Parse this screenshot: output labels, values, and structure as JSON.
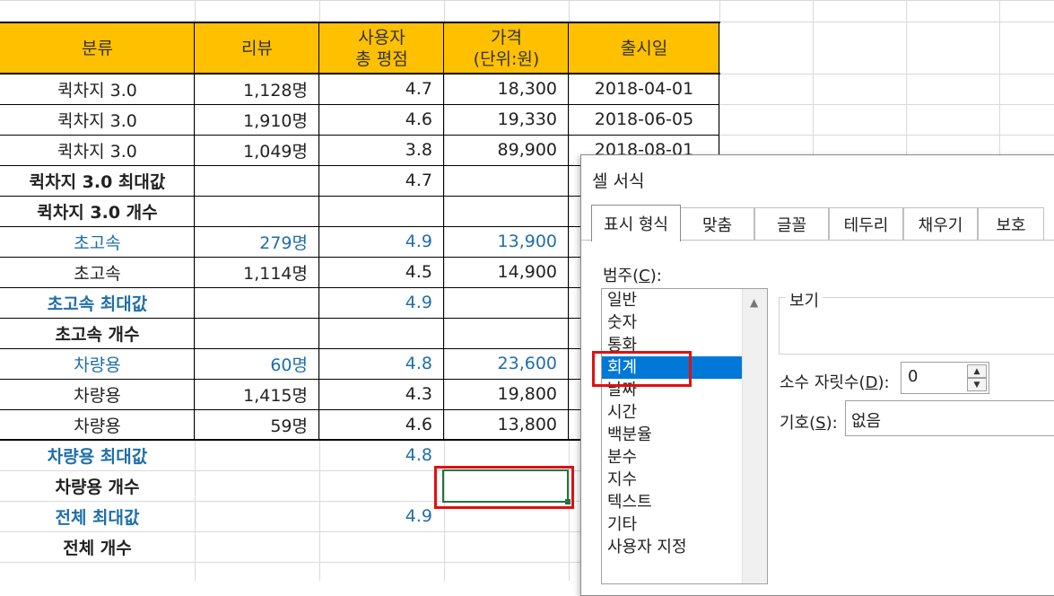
{
  "sheet": {
    "headers": {
      "category": "분류",
      "reviews": "리뷰",
      "rating_line1": "사용자",
      "rating_line2": "총 평점",
      "price_line1": "가격",
      "price_line2": "(단위:원)",
      "release": "출시일"
    },
    "rows": [
      {
        "category": "퀵차지 3.0",
        "reviews": "1,128명",
        "rating": "4.7",
        "price": "18,300",
        "release": "2018-04-01"
      },
      {
        "category": "퀵차지 3.0",
        "reviews": "1,910명",
        "rating": "4.6",
        "price": "19,330",
        "release": "2018-06-05"
      },
      {
        "category": "퀵차지 3.0",
        "reviews": "1,049명",
        "rating": "3.8",
        "price": "89,900",
        "release": "2018-08-01"
      },
      {
        "category": "퀵차지 3.0 최대값",
        "reviews": "",
        "rating": "4.7",
        "price": "",
        "release": ""
      },
      {
        "category": "퀵차지 3.0 개수",
        "reviews": "",
        "rating": "",
        "price": "",
        "release": ""
      },
      {
        "category": "초고속",
        "reviews": "279명",
        "rating": "4.9",
        "price": "13,900",
        "release": ""
      },
      {
        "category": "초고속",
        "reviews": "1,114명",
        "rating": "4.5",
        "price": "14,900",
        "release": ""
      },
      {
        "category": "초고속 최대값",
        "reviews": "",
        "rating": "4.9",
        "price": "",
        "release": ""
      },
      {
        "category": "초고속 개수",
        "reviews": "",
        "rating": "",
        "price": "",
        "release": ""
      },
      {
        "category": "차량용",
        "reviews": "60명",
        "rating": "4.8",
        "price": "23,600",
        "release": ""
      },
      {
        "category": "차량용",
        "reviews": "1,415명",
        "rating": "4.3",
        "price": "19,800",
        "release": ""
      },
      {
        "category": "차량용",
        "reviews": "59명",
        "rating": "4.6",
        "price": "13,800",
        "release": ""
      },
      {
        "category": "차량용 최대값",
        "reviews": "",
        "rating": "4.8",
        "price": "",
        "release": ""
      },
      {
        "category": "차량용 개수",
        "reviews": "",
        "rating": "",
        "price": "",
        "release": ""
      },
      {
        "category": "전체 최대값",
        "reviews": "",
        "rating": "4.9",
        "price": "",
        "release": ""
      },
      {
        "category": "전체 개수",
        "reviews": "",
        "rating": "",
        "price": "",
        "release": ""
      }
    ]
  },
  "dialog": {
    "title": "셀 서식",
    "tabs": [
      "표시 형식",
      "맞춤",
      "글꼴",
      "테두리",
      "채우기",
      "보호"
    ],
    "category_label": "범주",
    "category_hotkey": "C",
    "categories": [
      "일반",
      "숫자",
      "통화",
      "회계",
      "날짜",
      "시간",
      "백분율",
      "분수",
      "지수",
      "텍스트",
      "기타",
      "사용자 지정"
    ],
    "selected_category": "회계",
    "preview_label": "보기",
    "decimal_label": "소수 자릿수",
    "decimal_hotkey": "D",
    "decimal_value": "0",
    "symbol_label": "기호",
    "symbol_hotkey": "S",
    "symbol_value": "없음"
  },
  "colors": {
    "header_fill": "#ffc000",
    "highlight_text": "#1f6fa8",
    "selection_border": "#217346",
    "annotation_red": "#e01010",
    "list_selection": "#0078d7"
  }
}
